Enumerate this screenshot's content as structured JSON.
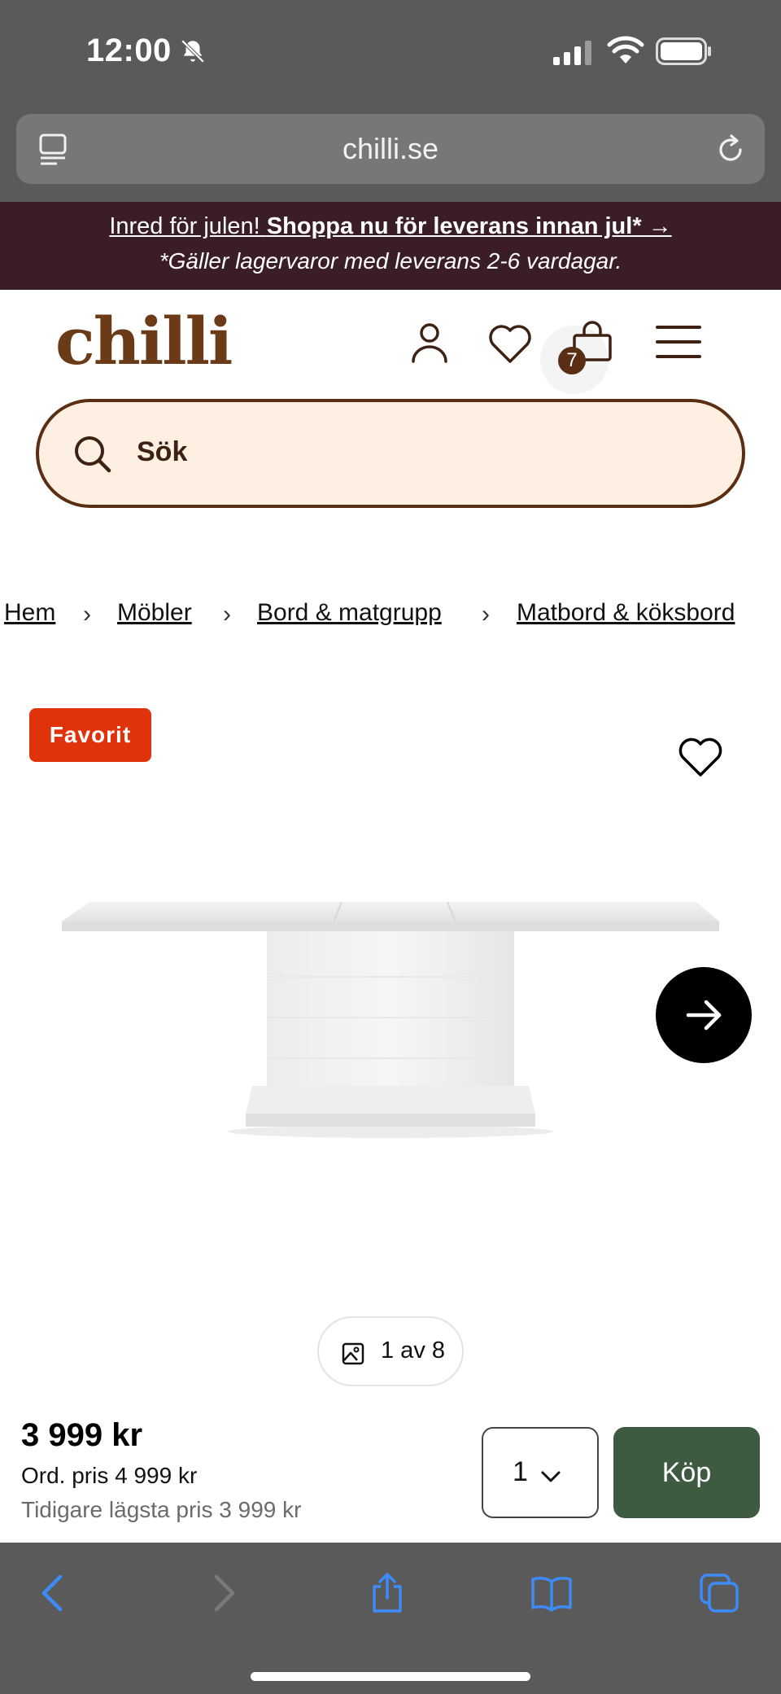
{
  "status_bar": {
    "time": "12:00"
  },
  "browser": {
    "url": "chilli.se"
  },
  "promo": {
    "line1_plain": "Inred för julen! ",
    "line1_bold": "Shoppa nu för leverans innan jul* →",
    "line2": "*Gäller lagervaror med leverans 2-6 vardagar."
  },
  "header": {
    "logo": "chilli",
    "cart_count": "7"
  },
  "search": {
    "placeholder": "Sök"
  },
  "breadcrumb": {
    "items": [
      "Hem",
      "Möbler",
      "Bord & matgrupp",
      "Matbord & köksbord"
    ],
    "separator": "›"
  },
  "product": {
    "badge": "Favorit",
    "image_counter": "1 av 8"
  },
  "purchase": {
    "price": "3 999 kr",
    "ordinary_price": "Ord. pris 4 999 kr",
    "lowest_price": "Tidigare lägsta pris 3 999 kr",
    "quantity": "1",
    "buy_label": "Köp"
  },
  "colors": {
    "accent_brown": "#5a2e12",
    "promo_bg": "#3a1d27",
    "badge_red": "#e0330c",
    "buy_green": "#3e5b41",
    "search_bg": "#fdf0e3",
    "ios_blue": "#3d8bf7"
  }
}
